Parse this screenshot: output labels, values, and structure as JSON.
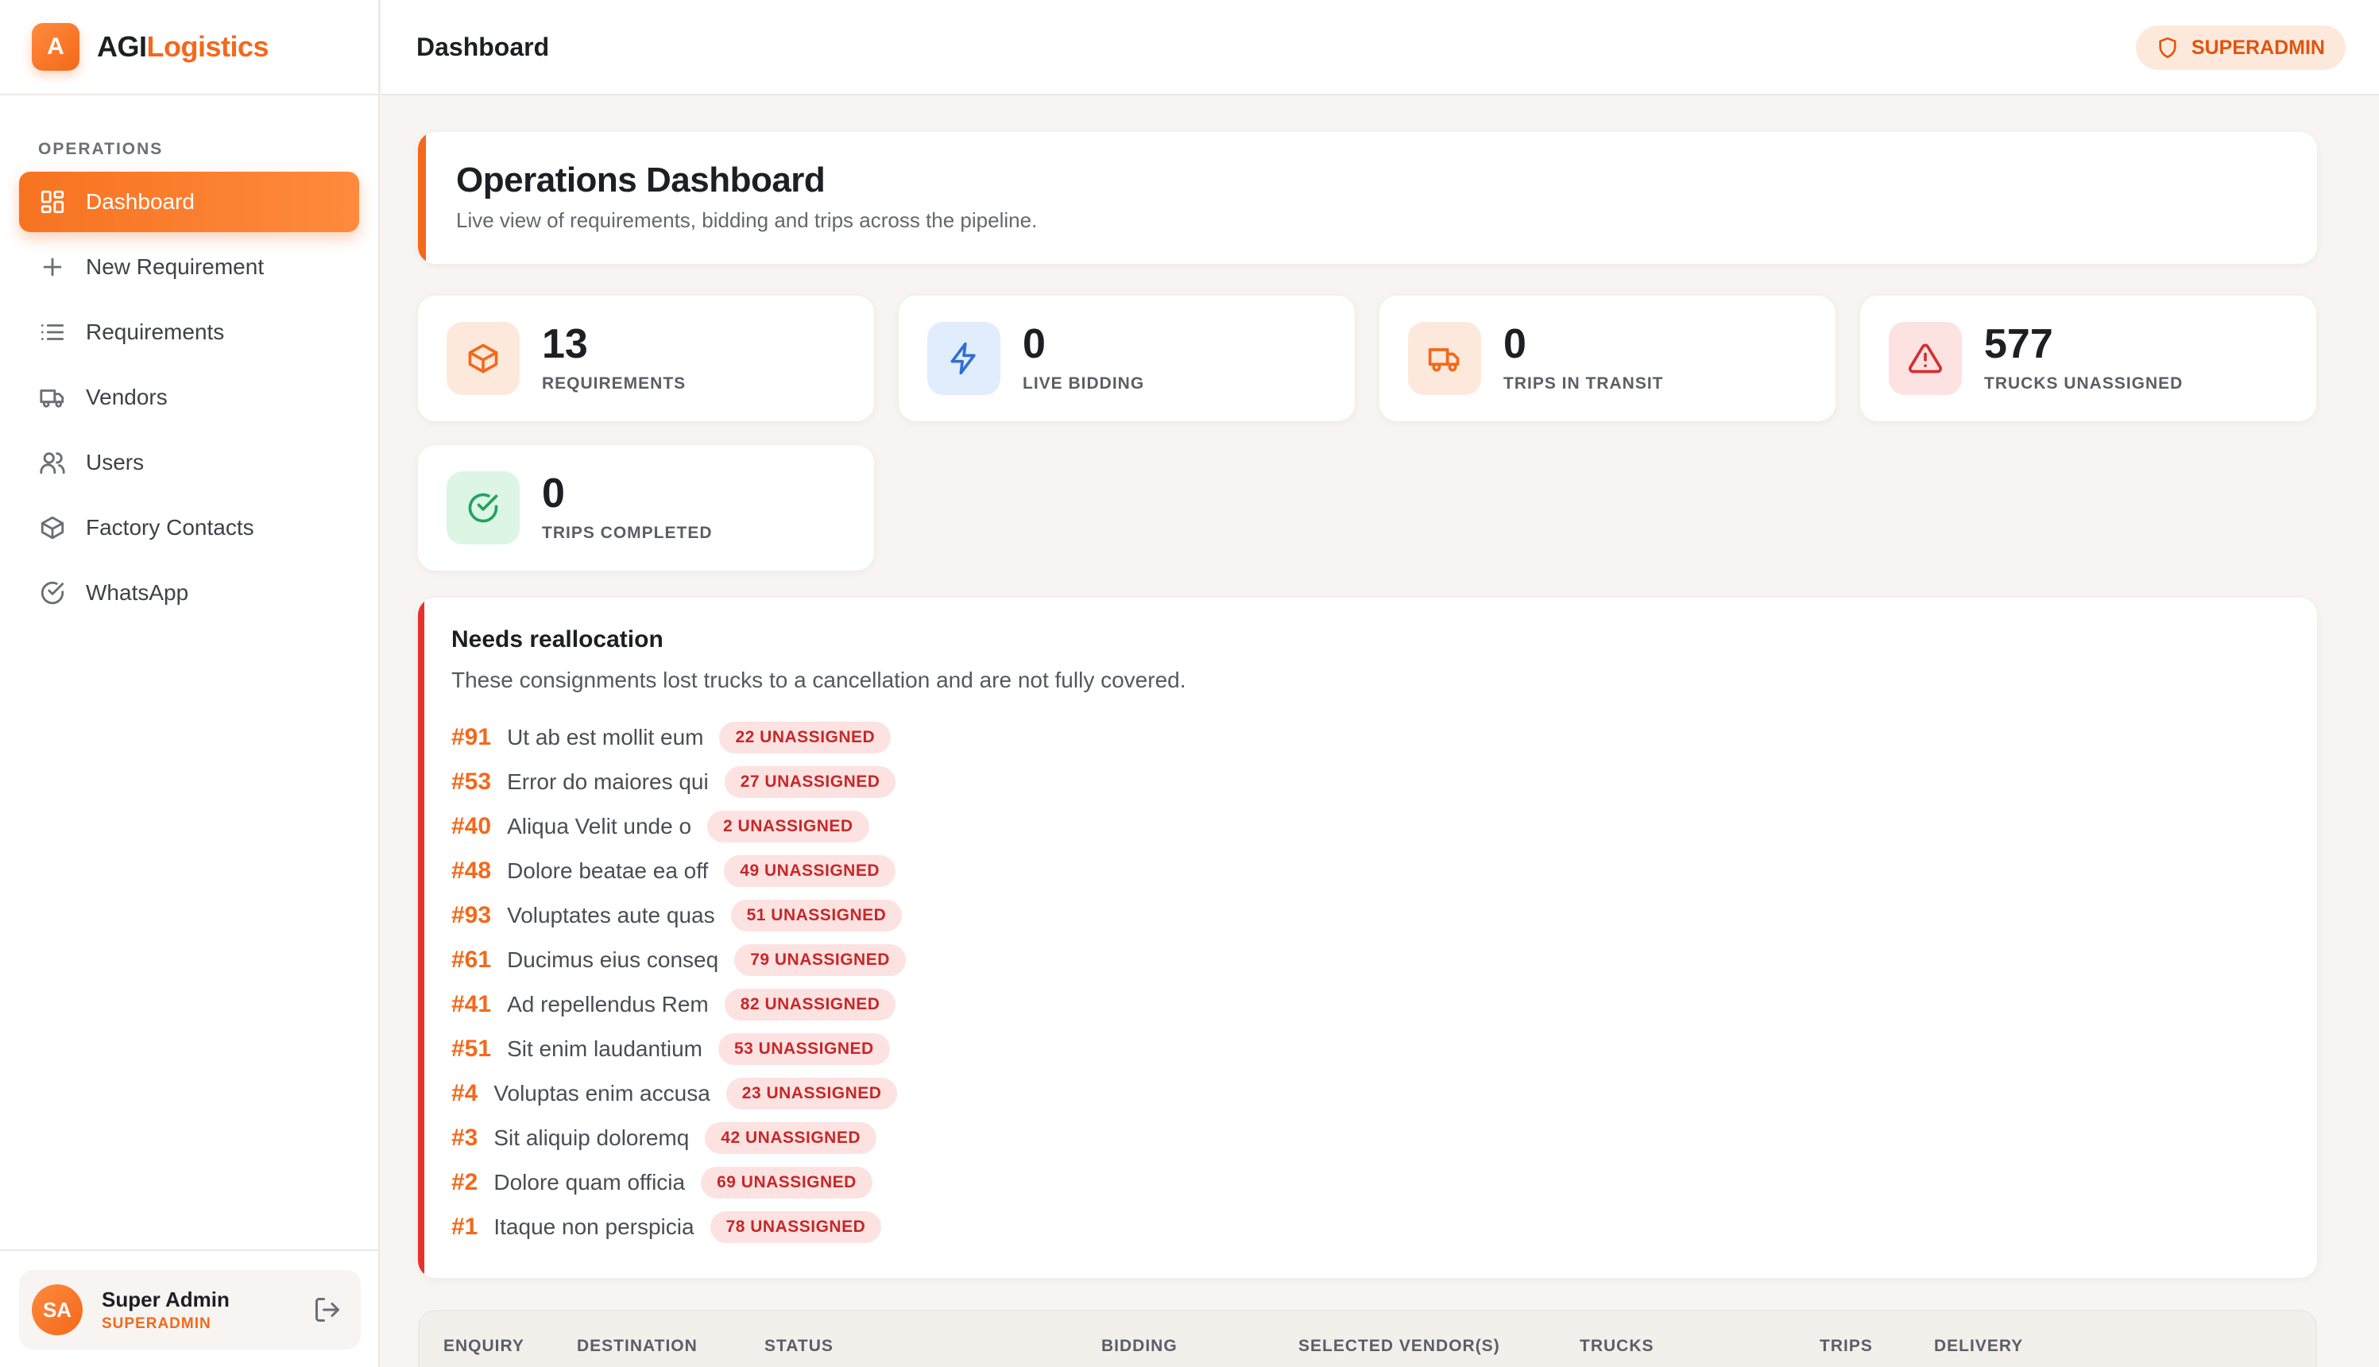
{
  "brand": {
    "logo_letter": "A",
    "name_part1": "AGI",
    "name_part2": "Logistics"
  },
  "sidebar": {
    "section_label": "OPERATIONS",
    "items": [
      {
        "label": "Dashboard",
        "icon": "grid-icon"
      },
      {
        "label": "New Requirement",
        "icon": "plus-icon"
      },
      {
        "label": "Requirements",
        "icon": "list-icon"
      },
      {
        "label": "Vendors",
        "icon": "truck-icon"
      },
      {
        "label": "Users",
        "icon": "users-icon"
      },
      {
        "label": "Factory Contacts",
        "icon": "box-icon"
      },
      {
        "label": "WhatsApp",
        "icon": "check-circle-icon"
      }
    ],
    "user": {
      "initials": "SA",
      "name": "Super Admin",
      "role": "SUPERADMIN"
    }
  },
  "header": {
    "title": "Dashboard",
    "role_badge": "SUPERADMIN"
  },
  "hero": {
    "title": "Operations Dashboard",
    "subtitle": "Live view of requirements, bidding and trips across the pipeline."
  },
  "stats": [
    {
      "value": "13",
      "label": "REQUIREMENTS",
      "icon": "box-icon",
      "color": "#f4681a",
      "bg": "#fde9dc"
    },
    {
      "value": "0",
      "label": "LIVE BIDDING",
      "icon": "lightning-icon",
      "color": "#2f6fd6",
      "bg": "#e1ecfd"
    },
    {
      "value": "0",
      "label": "TRIPS IN TRANSIT",
      "icon": "truck-icon",
      "color": "#f4681a",
      "bg": "#fde9dc"
    },
    {
      "value": "577",
      "label": "TRUCKS UNASSIGNED",
      "icon": "warning-icon",
      "color": "#d32f2f",
      "bg": "#fde2e2"
    },
    {
      "value": "0",
      "label": "TRIPS COMPLETED",
      "icon": "check-circle-icon",
      "color": "#22a35a",
      "bg": "#dcf5e5"
    }
  ],
  "reallocation": {
    "title": "Needs reallocation",
    "subtitle": "These consignments lost trucks to a cancellation and are not fully covered.",
    "rows": [
      {
        "id": "#91",
        "name": "Ut ab est mollit eum",
        "badge": "22 UNASSIGNED"
      },
      {
        "id": "#53",
        "name": "Error do maiores qui",
        "badge": "27 UNASSIGNED"
      },
      {
        "id": "#40",
        "name": "Aliqua Velit unde o",
        "badge": "2 UNASSIGNED"
      },
      {
        "id": "#48",
        "name": "Dolore beatae ea off",
        "badge": "49 UNASSIGNED"
      },
      {
        "id": "#93",
        "name": "Voluptates aute quas",
        "badge": "51 UNASSIGNED"
      },
      {
        "id": "#61",
        "name": "Ducimus eius conseq",
        "badge": "79 UNASSIGNED"
      },
      {
        "id": "#41",
        "name": "Ad repellendus Rem",
        "badge": "82 UNASSIGNED"
      },
      {
        "id": "#51",
        "name": "Sit enim laudantium",
        "badge": "53 UNASSIGNED"
      },
      {
        "id": "#4",
        "name": "Voluptas enim accusa",
        "badge": "23 UNASSIGNED"
      },
      {
        "id": "#3",
        "name": "Sit aliquip doloremq",
        "badge": "42 UNASSIGNED"
      },
      {
        "id": "#2",
        "name": "Dolore quam officia",
        "badge": "69 UNASSIGNED"
      },
      {
        "id": "#1",
        "name": "Itaque non perspicia",
        "badge": "78 UNASSIGNED"
      }
    ]
  },
  "table": {
    "columns": [
      "ENQUIRY",
      "DESTINATION",
      "STATUS",
      "BIDDING",
      "SELECTED VENDOR(S)",
      "TRUCKS",
      "TRIPS",
      "DELIVERY"
    ]
  }
}
